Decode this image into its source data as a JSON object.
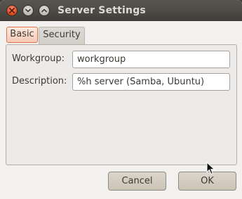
{
  "window": {
    "title": "Server Settings"
  },
  "window_controls": [
    {
      "name": "close",
      "icon": "close-icon"
    },
    {
      "name": "minimize",
      "icon": "minimize-icon"
    },
    {
      "name": "maximize",
      "icon": "maximize-icon"
    }
  ],
  "tabs": [
    {
      "label": "Basic",
      "active": true
    },
    {
      "label": "Security",
      "active": false
    }
  ],
  "form": {
    "workgroup_label": "Workgroup:",
    "workgroup_value": "workgroup",
    "description_label": "Description:",
    "description_value": "%h server (Samba, Ubuntu)"
  },
  "buttons": {
    "cancel_label": "Cancel",
    "ok_label": "OK"
  },
  "colors": {
    "titlebar": "#4a4944",
    "close_button": "#d9441c",
    "active_tab_border": "#e0704e",
    "window_bg": "#f2f1f0"
  }
}
